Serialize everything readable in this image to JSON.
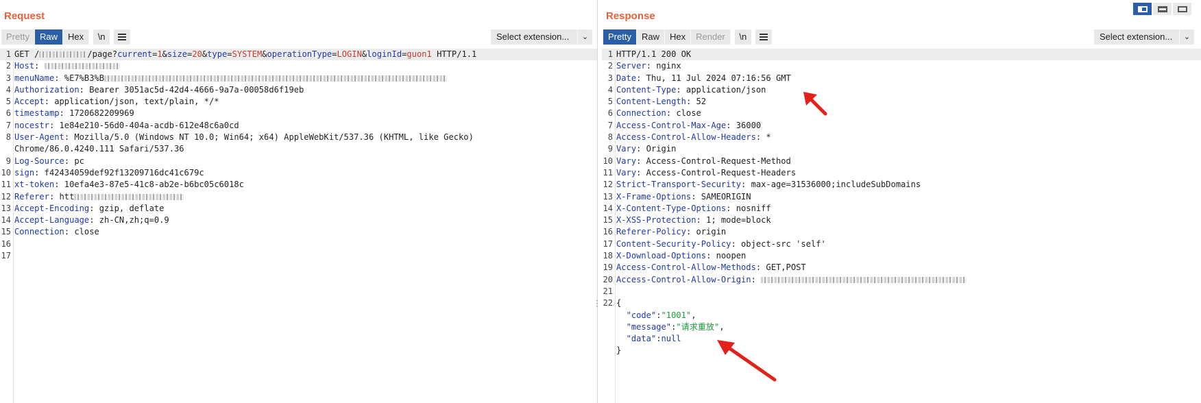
{
  "request": {
    "title": "Request",
    "tabs": [
      "Pretty",
      "Raw",
      "Hex"
    ],
    "active_tab": "Raw",
    "newline_btn": "\\n",
    "select_extension": "Select extension...",
    "lines": [
      {
        "n": "1",
        "parts": [
          [
            "t",
            "GET /"
          ],
          [
            "b",
            "70"
          ],
          [
            "t",
            "/page?"
          ],
          [
            "k",
            "current"
          ],
          [
            "t",
            "="
          ],
          [
            "pv",
            "1"
          ],
          [
            "t",
            "&"
          ],
          [
            "k",
            "size"
          ],
          [
            "t",
            "="
          ],
          [
            "pv",
            "20"
          ],
          [
            "t",
            "&"
          ],
          [
            "k",
            "type"
          ],
          [
            "t",
            "="
          ],
          [
            "pv",
            "SYSTEM"
          ],
          [
            "t",
            "&"
          ],
          [
            "k",
            "operationType"
          ],
          [
            "t",
            "="
          ],
          [
            "pv",
            "LOGIN"
          ],
          [
            "t",
            "&"
          ],
          [
            "k",
            "loginId"
          ],
          [
            "t",
            "="
          ],
          [
            "pv",
            "guon1"
          ],
          [
            "t",
            " HTTP/1.1"
          ]
        ]
      },
      {
        "n": "2",
        "parts": [
          [
            "k",
            "Host"
          ],
          [
            "t",
            ": "
          ],
          [
            "b",
            "110"
          ]
        ]
      },
      {
        "n": "3",
        "parts": [
          [
            "k",
            "menuName"
          ],
          [
            "t",
            ": %E7%B3%B"
          ],
          [
            "b",
            "500"
          ]
        ]
      },
      {
        "n": "4",
        "parts": [
          [
            "k",
            "Authorization"
          ],
          [
            "t",
            ": Bearer 3051ac5d-42d4-4666-9a7a-00058d6f19eb"
          ]
        ]
      },
      {
        "n": "5",
        "parts": [
          [
            "k",
            "Accept"
          ],
          [
            "t",
            ": application/json, text/plain, */*"
          ]
        ]
      },
      {
        "n": "6",
        "parts": [
          [
            "k",
            "timestamp"
          ],
          [
            "t",
            ": 1720682209969"
          ]
        ]
      },
      {
        "n": "7",
        "parts": [
          [
            "k",
            "nocestr"
          ],
          [
            "t",
            ": 1e84e210-56d0-404a-acdb-612e48c6a0cd"
          ]
        ]
      },
      {
        "n": "8",
        "parts": [
          [
            "k",
            "User-Agent"
          ],
          [
            "t",
            ": Mozilla/5.0 (Windows NT 10.0; Win64; x64) AppleWebKit/537.36 (KHTML, like Gecko)"
          ]
        ]
      },
      {
        "n": "",
        "parts": [
          [
            "t",
            "Chrome/86.0.4240.111 Safari/537.36"
          ]
        ]
      },
      {
        "n": "9",
        "parts": [
          [
            "k",
            "Log-Source"
          ],
          [
            "t",
            ": pc"
          ]
        ]
      },
      {
        "n": "10",
        "parts": [
          [
            "k",
            "sign"
          ],
          [
            "t",
            ": f42434059def92f13209716dc41c679c"
          ]
        ]
      },
      {
        "n": "11",
        "parts": [
          [
            "k",
            "xt-token"
          ],
          [
            "t",
            ": 10efa4e3-87e5-41c8-ab2e-b6bc05c6018c"
          ]
        ]
      },
      {
        "n": "12",
        "parts": [
          [
            "k",
            "Referer"
          ],
          [
            "t",
            ": htt"
          ],
          [
            "b",
            "160"
          ]
        ]
      },
      {
        "n": "13",
        "parts": [
          [
            "k",
            "Accept-Encoding"
          ],
          [
            "t",
            ": gzip, deflate"
          ]
        ]
      },
      {
        "n": "14",
        "parts": [
          [
            "k",
            "Accept-Language"
          ],
          [
            "t",
            ": zh-CN,zh;q=0.9"
          ]
        ]
      },
      {
        "n": "15",
        "parts": [
          [
            "k",
            "Connection"
          ],
          [
            "t",
            ": close"
          ]
        ]
      },
      {
        "n": "16",
        "parts": []
      },
      {
        "n": "17",
        "parts": []
      }
    ]
  },
  "response": {
    "title": "Response",
    "tabs": [
      "Pretty",
      "Raw",
      "Hex",
      "Render"
    ],
    "active_tab": "Pretty",
    "newline_btn": "\\n",
    "select_extension": "Select extension...",
    "lines": [
      {
        "n": "1",
        "parts": [
          [
            "t",
            "HTTP/1.1 200 OK"
          ]
        ]
      },
      {
        "n": "2",
        "parts": [
          [
            "k",
            "Server"
          ],
          [
            "t",
            ": nginx"
          ]
        ]
      },
      {
        "n": "3",
        "parts": [
          [
            "k",
            "Date"
          ],
          [
            "t",
            ": Thu, 11 Jul 2024 07:16:56 GMT"
          ]
        ]
      },
      {
        "n": "4",
        "parts": [
          [
            "k",
            "Content-Type"
          ],
          [
            "t",
            ": application/json"
          ]
        ]
      },
      {
        "n": "5",
        "parts": [
          [
            "k",
            "Content-Length"
          ],
          [
            "t",
            ": 52"
          ]
        ]
      },
      {
        "n": "6",
        "parts": [
          [
            "k",
            "Connection"
          ],
          [
            "t",
            ": close"
          ]
        ]
      },
      {
        "n": "7",
        "parts": [
          [
            "k",
            "Access-Control-Max-Age"
          ],
          [
            "t",
            ": 36000"
          ]
        ]
      },
      {
        "n": "8",
        "parts": [
          [
            "k",
            "Access-Control-Allow-Headers"
          ],
          [
            "t",
            ": *"
          ]
        ]
      },
      {
        "n": "9",
        "parts": [
          [
            "k",
            "Vary"
          ],
          [
            "t",
            ": Origin"
          ]
        ]
      },
      {
        "n": "10",
        "parts": [
          [
            "k",
            "Vary"
          ],
          [
            "t",
            ": Access-Control-Request-Method"
          ]
        ]
      },
      {
        "n": "11",
        "parts": [
          [
            "k",
            "Vary"
          ],
          [
            "t",
            ": Access-Control-Request-Headers"
          ]
        ]
      },
      {
        "n": "12",
        "parts": [
          [
            "k",
            "Strict-Transport-Security"
          ],
          [
            "t",
            ": max-age=31536000;includeSubDomains"
          ]
        ]
      },
      {
        "n": "13",
        "parts": [
          [
            "k",
            "X-Frame-Options"
          ],
          [
            "t",
            ": SAMEORIGIN"
          ]
        ]
      },
      {
        "n": "14",
        "parts": [
          [
            "k",
            "X-Content-Type-Options"
          ],
          [
            "t",
            ": nosniff"
          ]
        ]
      },
      {
        "n": "15",
        "parts": [
          [
            "k",
            "X-XSS-Protection"
          ],
          [
            "t",
            ": 1; mode=block"
          ]
        ]
      },
      {
        "n": "16",
        "parts": [
          [
            "k",
            "Referer-Policy"
          ],
          [
            "t",
            ": origin"
          ]
        ]
      },
      {
        "n": "17",
        "parts": [
          [
            "k",
            "Content-Security-Policy"
          ],
          [
            "t",
            ": object-src 'self'"
          ]
        ]
      },
      {
        "n": "18",
        "parts": [
          [
            "k",
            "X-Download-Options"
          ],
          [
            "t",
            ": noopen"
          ]
        ]
      },
      {
        "n": "19",
        "parts": [
          [
            "k",
            "Access-Control-Allow-Methods"
          ],
          [
            "t",
            ": GET,POST"
          ]
        ]
      },
      {
        "n": "20",
        "parts": [
          [
            "k",
            "Access-Control-Allow-Origin"
          ],
          [
            "t",
            ": "
          ],
          [
            "b",
            "300"
          ]
        ]
      },
      {
        "n": "21",
        "parts": []
      },
      {
        "n": "22",
        "parts": [
          [
            "t",
            "{"
          ]
        ]
      },
      {
        "n": "",
        "parts": [
          [
            "t",
            "  "
          ],
          [
            "k",
            "\"code\""
          ],
          [
            "t",
            ":"
          ],
          [
            "str",
            "\"1001\""
          ],
          [
            "t",
            ","
          ]
        ]
      },
      {
        "n": "",
        "parts": [
          [
            "t",
            "  "
          ],
          [
            "k",
            "\"message\""
          ],
          [
            "t",
            ":"
          ],
          [
            "str",
            "\"请求重放\""
          ],
          [
            "t",
            ","
          ]
        ]
      },
      {
        "n": "",
        "parts": [
          [
            "t",
            "  "
          ],
          [
            "k",
            "\"data\""
          ],
          [
            "t",
            ":"
          ],
          [
            "k",
            "null"
          ]
        ]
      },
      {
        "n": "",
        "parts": [
          [
            "t",
            "}"
          ]
        ]
      }
    ]
  },
  "view_buttons": [
    "split-columns-icon",
    "split-rows-icon",
    "single-pane-icon"
  ],
  "colors": {
    "accent": "#e8603c",
    "active_tab": "#2b5ea8",
    "key": "#1f3aa8",
    "param_value": "#c83a2a",
    "string": "#1a9a3a",
    "arrow": "#e3201b"
  }
}
